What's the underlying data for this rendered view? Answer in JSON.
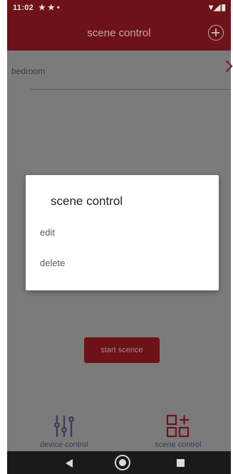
{
  "status_bar": {
    "time": "11:02",
    "notification_icons": "★ ★ •",
    "system_icons": "▾◢▮"
  },
  "header": {
    "title": "scene control",
    "add_icon": "plus-circle-icon"
  },
  "scene_list": {
    "items": [
      {
        "label": "bedroom"
      }
    ]
  },
  "start_button": {
    "label": "start scence"
  },
  "dialog": {
    "title": "scene control",
    "items": [
      {
        "label": "edit"
      },
      {
        "label": "delete"
      }
    ]
  },
  "tabs": [
    {
      "label": "device control",
      "icon": "sliders-icon"
    },
    {
      "label": "scene control",
      "icon": "grid-plus-icon"
    }
  ],
  "nav_bar": {
    "back_icon": "back-triangle-icon",
    "home_icon": "home-circle-icon",
    "recent_icon": "recents-square-icon"
  },
  "colors": {
    "primary": "#6d1218",
    "overlay_content": "#7b7b7b",
    "dialog_background": "#ffffff",
    "tab_label": "#3a3c5c",
    "nav_bar": "#1a1a1a"
  }
}
